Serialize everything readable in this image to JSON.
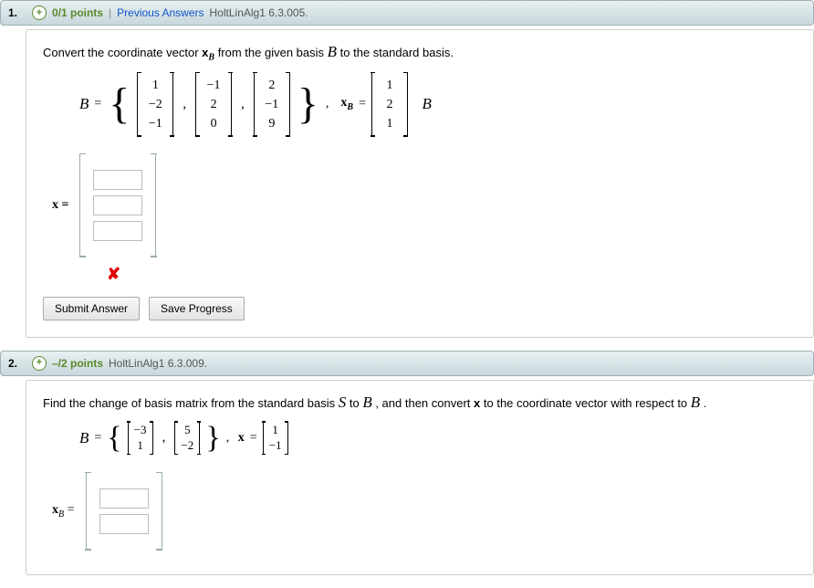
{
  "q1": {
    "number": "1.",
    "points": "0/1 points",
    "sep": " | ",
    "prev": "Previous Answers",
    "ref": "HoltLinAlg1 6.3.005.",
    "prompt_a": "Convert the coordinate vector ",
    "prompt_xB": "x",
    "prompt_Bs": "B",
    "prompt_b": " from the given basis ",
    "prompt_c": " to the standard basis.",
    "B_label": "B",
    "equals": " = ",
    "v1": [
      "1",
      "−2",
      "−1"
    ],
    "v2": [
      "−1",
      "2",
      "0"
    ],
    "v3": [
      "2",
      "−1",
      "9"
    ],
    "xB_label": "x",
    "xB_sub": "B",
    "xB_vec": [
      "1",
      "2",
      "1"
    ],
    "trail_B": "B",
    "ans_label": "x =",
    "wrong": "✘",
    "submit": "Submit Answer",
    "save": "Save Progress"
  },
  "q2": {
    "number": "2.",
    "points": "–/2 points",
    "ref": "HoltLinAlg1 6.3.009.",
    "prompt_a": "Find the change of basis matrix from the standard basis ",
    "prompt_b": " to ",
    "prompt_c": ", and then convert ",
    "prompt_x": "x",
    "prompt_d": " to the coordinate vector with respect to ",
    "prompt_e": ".",
    "S_label": "S",
    "B_label": "B",
    "equals": " = ",
    "v1": [
      "−3",
      "1"
    ],
    "v2": [
      "5",
      "−2"
    ],
    "x_label": "x",
    "x_vec": [
      "1",
      "−1"
    ],
    "ans_label_x": "x",
    "ans_label_sub": "B",
    "ans_eq": " ="
  }
}
